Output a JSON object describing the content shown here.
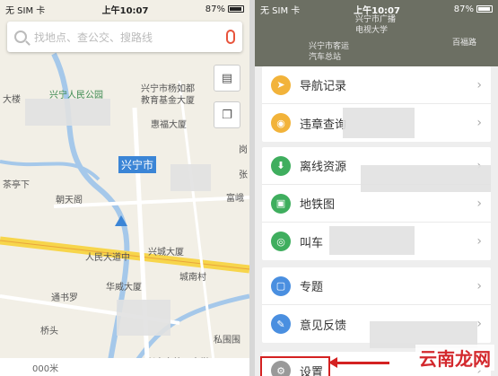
{
  "left": {
    "status": {
      "carrier": "无 SIM 卡",
      "time": "上午10:07",
      "battery": "87%"
    },
    "search": {
      "placeholder": "找地点、查公交、搜路线"
    },
    "map_labels": [
      "兴宁人民公园",
      "兴宁市杨如都",
      "教育基金大厦",
      "惠福大厦",
      "兴宁市",
      "朝天阁",
      "人民大道中",
      "兴城大厦",
      "城南村",
      "华威大厦",
      "通书罗",
      "私围围",
      "桥头",
      "兴宁市第一中学",
      "富峨",
      "张",
      "茶亭下",
      "大楼",
      "岗"
    ],
    "bottom": {
      "text": "000米"
    }
  },
  "right": {
    "status": {
      "carrier": "无 SIM 卡",
      "time": "上午10:07",
      "battery": "87%"
    },
    "map_labels": [
      "兴宁市广播",
      "电视大学",
      "兴宁市客运",
      "汽车总站",
      "百福路"
    ],
    "menu_groups": [
      [
        {
          "label": "导航记录",
          "icon": "navigation-history-icon",
          "color": "#f2b33a"
        },
        {
          "label": "违章查询",
          "icon": "violation-query-icon",
          "color": "#f2b33a"
        }
      ],
      [
        {
          "label": "离线资源",
          "icon": "offline-resource-icon",
          "color": "#3fae5e"
        },
        {
          "label": "地铁图",
          "icon": "subway-map-icon",
          "color": "#3fae5e"
        },
        {
          "label": "叫车",
          "icon": "taxi-icon",
          "color": "#3fae5e"
        }
      ],
      [
        {
          "label": "专题",
          "icon": "topic-icon",
          "color": "#4a8fe0"
        },
        {
          "label": "意见反馈",
          "icon": "feedback-icon",
          "color": "#4a8fe0"
        }
      ],
      [
        {
          "label": "设置",
          "icon": "gear-icon",
          "color": "#999999"
        }
      ]
    ]
  },
  "watermark": "云南龙网"
}
